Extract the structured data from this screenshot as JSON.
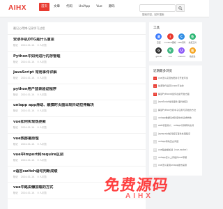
{
  "brand": {
    "logo_text": "AIHX",
    "accent": "#e83a30"
  },
  "nav": [
    {
      "label": "首页",
      "active": true
    },
    {
      "label": "文章",
      "active": false
    },
    {
      "label": "代码",
      "active": false
    },
    {
      "label": "UniApp",
      "active": false
    },
    {
      "label": "Vue",
      "active": false
    },
    {
      "label": "源码",
      "active": false
    }
  ],
  "search": {
    "placeholder": "搜索内容，回车搜索",
    "icon": "search-icon"
  },
  "breadcrumb": "最记心得博·记录学习过程",
  "articles": [
    {
      "title": "安卓手机OTG是什么意思",
      "author": "随记",
      "date": "2024-01-14",
      "views": "0 人浏览"
    },
    {
      "title": "Python中如何进行内存管理",
      "author": "随记",
      "date": "2024-01-14",
      "views": "0 人浏览"
    },
    {
      "title": "JavaScript 常用事件详解",
      "author": "随记",
      "date": "2024-01-14",
      "views": "0 人浏览"
    },
    {
      "title": "python用户登录验证程序",
      "author": "随记",
      "date": "2024-01-14",
      "views": "0 人浏览"
    },
    {
      "title": "uniapp app滑动、触摸时页面出现抖动拉伸解决",
      "author": "随记",
      "date": "2024-01-14",
      "views": "0 人浏览"
    },
    {
      "title": "vue如何实现热更新",
      "author": "随记",
      "date": "2024-01-14",
      "views": "0 人浏览"
    },
    {
      "title": "vue热部署原理",
      "author": "随记",
      "date": "2024-01-14",
      "views": "0 人浏览"
    },
    {
      "title": "vue中import和require区别",
      "author": "随记",
      "date": "2024-01-14",
      "views": "0 人浏览"
    },
    {
      "title": "c语言switch语句判断成绩",
      "author": "随记",
      "date": "2024-01-14",
      "views": "0 人浏览"
    },
    {
      "title": "vue中路由懒加载的方式",
      "author": "随记",
      "date": "2024-01-14",
      "views": "0 人浏览"
    }
  ],
  "tools_card": {
    "title": "工具",
    "items": [
      {
        "label": "百度",
        "color": "#3a7afe",
        "glyph": "度"
      },
      {
        "label": "iconfont图标",
        "color": "#e83a30",
        "glyph": "i"
      },
      {
        "label": "CSS代码",
        "color": "#2f8de4",
        "glyph": "C"
      },
      {
        "label": "免费工具",
        "color": "#2bb673",
        "glyph": "免"
      },
      {
        "label": "github",
        "color": "#333333",
        "glyph": "G"
      },
      {
        "label": "vue",
        "color": "#41b883",
        "glyph": "V"
      },
      {
        "label": "uiboard",
        "color": "#8e5cf7",
        "glyph": "U"
      },
      {
        "label": "格式化",
        "color": "#f5a623",
        "glyph": "格"
      }
    ]
  },
  "recent_card": {
    "title": "近期最多浏览",
    "items": [
      "vue怎么实现热更新与开发环境",
      "拍卖软件是怎么app平台的",
      "解读Python中如何在新开发方面",
      "JavaScript常用事件(事件绑定)",
      "解读Python分析中子任务与高效的方法",
      "uniapp数据请求封装中的请求参数",
      "web项目简介：uniapp代码转码支持",
      "javascript如何编写事件处理程序",
      "uniapp滑动空白问题",
      "vue路由懒加载（vue-router）",
      "uniapp怎么上传组件vue带模",
      "vue怎么使用uniapp发布提测"
    ]
  },
  "watermark": {
    "main": "免费源码",
    "sub": "AIHX"
  }
}
